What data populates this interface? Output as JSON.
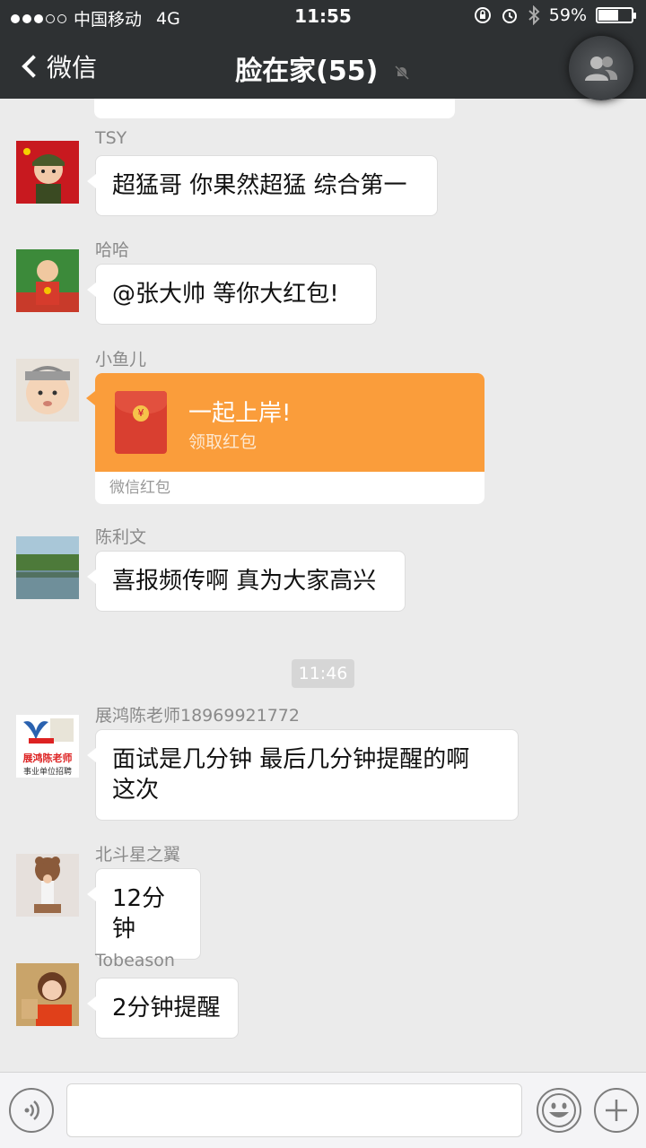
{
  "status_bar": {
    "carrier": "中国移动",
    "network": "4G",
    "time": "11:55",
    "battery_percent": "59%",
    "battery_level": 0.59
  },
  "nav": {
    "back_label": "微信",
    "title": "脸在家(55)"
  },
  "messages": [
    {
      "sender": "TSY",
      "text": "超猛哥 你果然超猛 综合第一"
    },
    {
      "sender": "哈哈",
      "text": "@张大帅 等你大红包!"
    },
    {
      "sender": "小鱼儿",
      "red_packet": {
        "title": "一起上岸!",
        "subtitle": "领取红包",
        "footer": "微信红包"
      }
    },
    {
      "sender": "陈利文",
      "text": "喜报频传啊 真为大家高兴"
    },
    {
      "sender": "展鸿陈老师18969921772",
      "text_line1": "面试是几分钟 最后几分钟提醒的啊",
      "text_line2": "这次",
      "avatar_logo_text": "展鸿陈老师",
      "avatar_logo_sub": "事业单位招聘"
    },
    {
      "sender": "北斗星之翼",
      "text": "12分钟"
    },
    {
      "sender": "Tobeason",
      "text": "2分钟提醒"
    }
  ],
  "time_divider": "11:46",
  "colors": {
    "nav_bg": "#2e3133",
    "chat_bg": "#ebebeb",
    "red_packet": "#fa9d3b"
  },
  "icons": {
    "voice": "voice-icon",
    "emoji": "emoji-icon",
    "plus": "plus-icon",
    "group": "group-icon",
    "mute": "mute-icon"
  }
}
